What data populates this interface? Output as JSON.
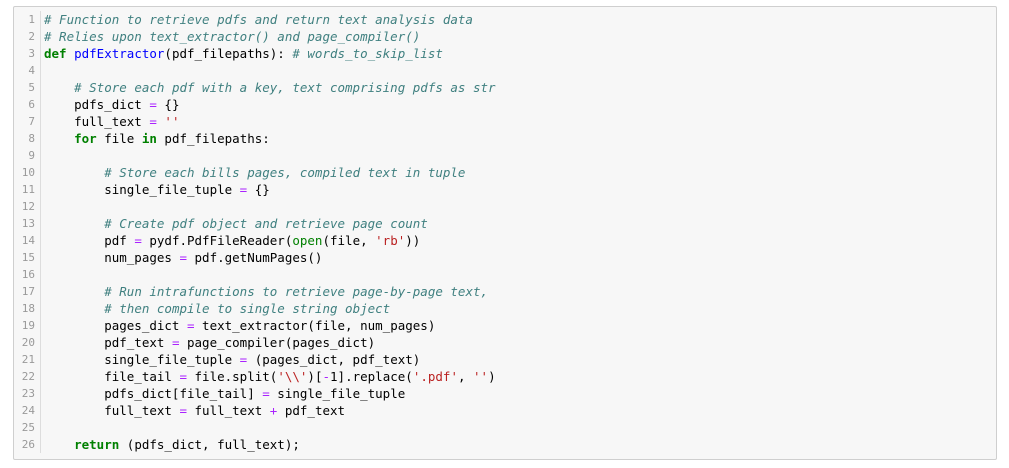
{
  "editor": {
    "lines": [
      {
        "n": "1",
        "tokens": [
          {
            "t": "c",
            "v": "# Function to retrieve pdfs and return text analysis data"
          }
        ]
      },
      {
        "n": "2",
        "tokens": [
          {
            "t": "c",
            "v": "# Relies upon text_extractor() and page_compiler()"
          }
        ]
      },
      {
        "n": "3",
        "tokens": [
          {
            "t": "k",
            "v": "def"
          },
          {
            "t": "p",
            "v": " "
          },
          {
            "t": "nf",
            "v": "pdfExtractor"
          },
          {
            "t": "p",
            "v": "(pdf_filepaths): "
          },
          {
            "t": "c",
            "v": "# words_to_skip_list"
          }
        ]
      },
      {
        "n": "4",
        "tokens": []
      },
      {
        "n": "5",
        "tokens": [
          {
            "t": "p",
            "v": "    "
          },
          {
            "t": "c",
            "v": "# Store each pdf with a key, text comprising pdfs as str"
          }
        ]
      },
      {
        "n": "6",
        "tokens": [
          {
            "t": "p",
            "v": "    pdfs_dict "
          },
          {
            "t": "o",
            "v": "="
          },
          {
            "t": "p",
            "v": " {}"
          }
        ]
      },
      {
        "n": "7",
        "tokens": [
          {
            "t": "p",
            "v": "    full_text "
          },
          {
            "t": "o",
            "v": "="
          },
          {
            "t": "p",
            "v": " "
          },
          {
            "t": "s",
            "v": "''"
          }
        ]
      },
      {
        "n": "8",
        "tokens": [
          {
            "t": "p",
            "v": "    "
          },
          {
            "t": "k",
            "v": "for"
          },
          {
            "t": "p",
            "v": " file "
          },
          {
            "t": "k",
            "v": "in"
          },
          {
            "t": "p",
            "v": " pdf_filepaths:"
          }
        ]
      },
      {
        "n": "9",
        "tokens": []
      },
      {
        "n": "10",
        "tokens": [
          {
            "t": "p",
            "v": "        "
          },
          {
            "t": "c",
            "v": "# Store each bills pages, compiled text in tuple"
          }
        ]
      },
      {
        "n": "11",
        "tokens": [
          {
            "t": "p",
            "v": "        single_file_tuple "
          },
          {
            "t": "o",
            "v": "="
          },
          {
            "t": "p",
            "v": " {}"
          }
        ]
      },
      {
        "n": "12",
        "tokens": []
      },
      {
        "n": "13",
        "tokens": [
          {
            "t": "p",
            "v": "        "
          },
          {
            "t": "c",
            "v": "# Create pdf object and retrieve page count"
          }
        ]
      },
      {
        "n": "14",
        "tokens": [
          {
            "t": "p",
            "v": "        pdf "
          },
          {
            "t": "o",
            "v": "="
          },
          {
            "t": "p",
            "v": " pydf.PdfFileReader("
          },
          {
            "t": "nb",
            "v": "open"
          },
          {
            "t": "p",
            "v": "(file, "
          },
          {
            "t": "s",
            "v": "'rb'"
          },
          {
            "t": "p",
            "v": "))"
          }
        ]
      },
      {
        "n": "15",
        "tokens": [
          {
            "t": "p",
            "v": "        num_pages "
          },
          {
            "t": "o",
            "v": "="
          },
          {
            "t": "p",
            "v": " pdf.getNumPages()"
          }
        ]
      },
      {
        "n": "16",
        "tokens": []
      },
      {
        "n": "17",
        "tokens": [
          {
            "t": "p",
            "v": "        "
          },
          {
            "t": "c",
            "v": "# Run intrafunctions to retrieve page-by-page text,"
          }
        ]
      },
      {
        "n": "18",
        "tokens": [
          {
            "t": "p",
            "v": "        "
          },
          {
            "t": "c",
            "v": "# then compile to single string object"
          }
        ]
      },
      {
        "n": "19",
        "tokens": [
          {
            "t": "p",
            "v": "        pages_dict "
          },
          {
            "t": "o",
            "v": "="
          },
          {
            "t": "p",
            "v": " text_extractor(file, num_pages)"
          }
        ]
      },
      {
        "n": "20",
        "tokens": [
          {
            "t": "p",
            "v": "        pdf_text "
          },
          {
            "t": "o",
            "v": "="
          },
          {
            "t": "p",
            "v": " page_compiler(pages_dict)"
          }
        ]
      },
      {
        "n": "21",
        "tokens": [
          {
            "t": "p",
            "v": "        single_file_tuple "
          },
          {
            "t": "o",
            "v": "="
          },
          {
            "t": "p",
            "v": " (pages_dict, pdf_text)"
          }
        ]
      },
      {
        "n": "22",
        "tokens": [
          {
            "t": "p",
            "v": "        file_tail "
          },
          {
            "t": "o",
            "v": "="
          },
          {
            "t": "p",
            "v": " file.split("
          },
          {
            "t": "s",
            "v": "'\\\\'"
          },
          {
            "t": "p",
            "v": ")["
          },
          {
            "t": "o",
            "v": "-"
          },
          {
            "t": "p",
            "v": "1].replace("
          },
          {
            "t": "s",
            "v": "'.pdf'"
          },
          {
            "t": "p",
            "v": ", "
          },
          {
            "t": "s",
            "v": "''"
          },
          {
            "t": "p",
            "v": ")"
          }
        ]
      },
      {
        "n": "23",
        "tokens": [
          {
            "t": "p",
            "v": "        pdfs_dict[file_tail] "
          },
          {
            "t": "o",
            "v": "="
          },
          {
            "t": "p",
            "v": " single_file_tuple"
          }
        ]
      },
      {
        "n": "24",
        "tokens": [
          {
            "t": "p",
            "v": "        full_text "
          },
          {
            "t": "o",
            "v": "="
          },
          {
            "t": "p",
            "v": " full_text "
          },
          {
            "t": "o",
            "v": "+"
          },
          {
            "t": "p",
            "v": " pdf_text"
          }
        ]
      },
      {
        "n": "25",
        "tokens": []
      },
      {
        "n": "26",
        "tokens": [
          {
            "t": "p",
            "v": "    "
          },
          {
            "t": "k",
            "v": "return"
          },
          {
            "t": "p",
            "v": " (pdfs_dict, full_text);"
          }
        ]
      }
    ]
  }
}
